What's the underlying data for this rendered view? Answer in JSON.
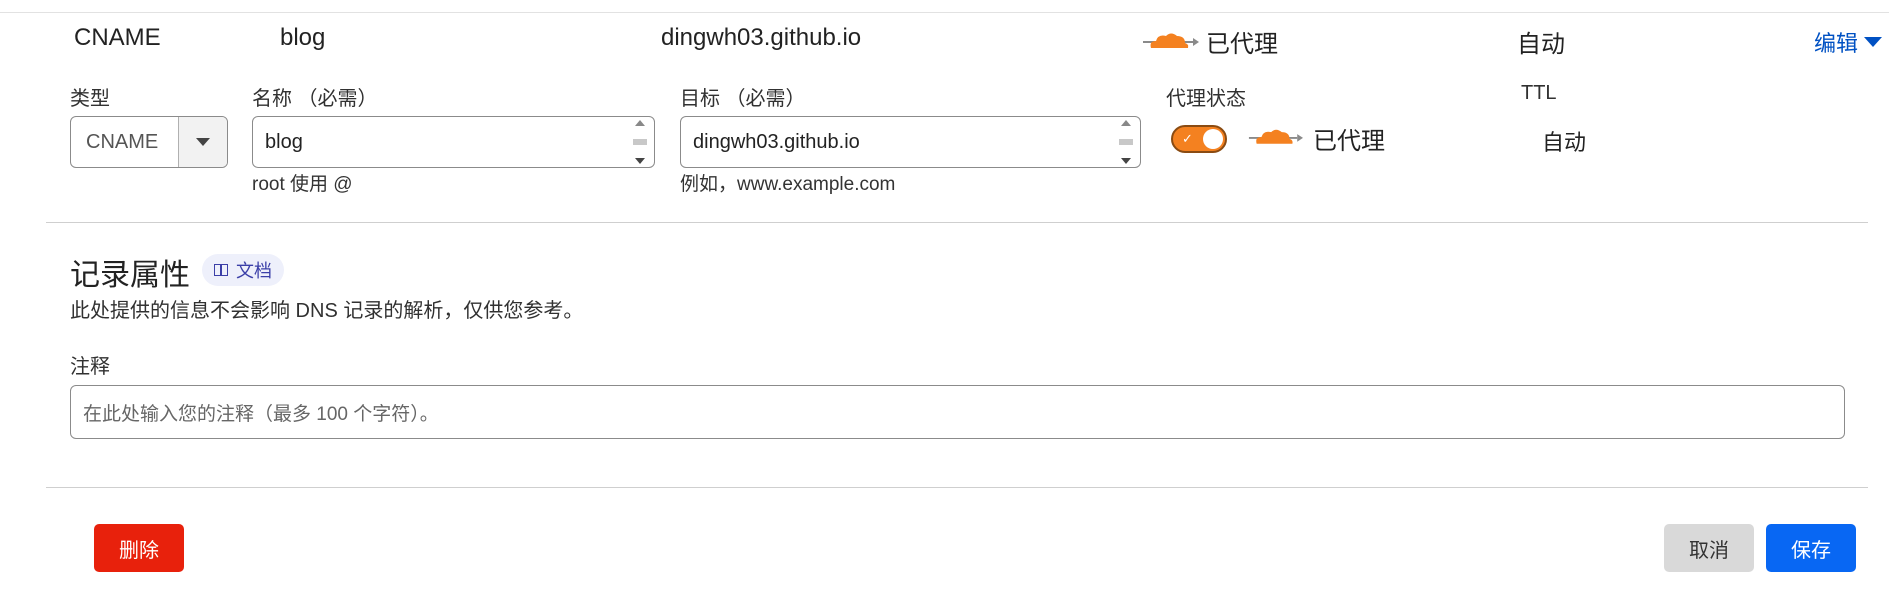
{
  "summary": {
    "type": "CNAME",
    "name": "blog",
    "target": "dingwh03.github.io",
    "proxy_status": "已代理",
    "ttl": "自动",
    "edit_label": "编辑"
  },
  "form": {
    "type_label": "类型",
    "type_value": "CNAME",
    "name_label": "名称 （必需）",
    "name_value": "blog",
    "name_hint": "root 使用 @",
    "target_label": "目标 （必需）",
    "target_value": "dingwh03.github.io",
    "target_hint": "例如，www.example.com",
    "proxy_label": "代理状态",
    "proxy_on": true,
    "proxy_value": "已代理",
    "ttl_label": "TTL",
    "ttl_value": "自动"
  },
  "record_attributes": {
    "title": "记录属性",
    "doc_badge": "文档",
    "description": "此处提供的信息不会影响 DNS 记录的解析，仅供您参考。",
    "comment_label": "注释",
    "comment_placeholder": "在此处输入您的注释（最多 100 个字符）。"
  },
  "actions": {
    "delete_label": "删除",
    "cancel_label": "取消",
    "save_label": "保存"
  },
  "colors": {
    "accent": "#0051c3",
    "proxy_orange": "#f48120",
    "delete": "#e8210c",
    "save": "#0867f3"
  },
  "icons": [
    "proxied-cloud-icon",
    "chevron-down-icon",
    "book-icon",
    "check-icon"
  ]
}
